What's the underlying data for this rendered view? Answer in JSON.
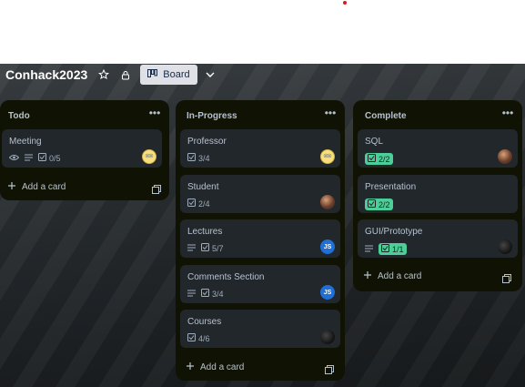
{
  "board": {
    "title": "Conhack2023",
    "view_label": "Board"
  },
  "lists": [
    {
      "title": "Todo",
      "add_label": "Add a card",
      "cards": [
        {
          "title": "Meeting",
          "checklist": "0/5",
          "avatar": "emoji-avatar"
        }
      ]
    },
    {
      "title": "In-Progress",
      "add_label": "Add a card",
      "cards": [
        {
          "title": "Professor",
          "checklist": "3/4",
          "avatar": "emoji-avatar"
        },
        {
          "title": "Student",
          "checklist": "2/4",
          "avatar": "photo-avatar"
        },
        {
          "title": "Lectures",
          "checklist": "5/7",
          "avatar_initials": "JS"
        },
        {
          "title": "Comments Section",
          "checklist": "3/4",
          "avatar_initials": "JS"
        },
        {
          "title": "Courses",
          "checklist": "4/6",
          "avatar": "dark-avatar"
        }
      ]
    },
    {
      "title": "Complete",
      "add_label": "Add a card",
      "cards": [
        {
          "title": "SQL",
          "checklist": "2/2",
          "avatar": "photo-avatar"
        },
        {
          "title": "Presentation",
          "checklist": "2/2"
        },
        {
          "title": "GUI/Prototype",
          "checklist": "1/1",
          "avatar": "dark-avatar"
        }
      ]
    }
  ],
  "colors": {
    "list_bg": "#101204",
    "card_bg": "#22272b",
    "complete_badge": "#4bce97",
    "avatar_blue": "#1f6fd6"
  }
}
